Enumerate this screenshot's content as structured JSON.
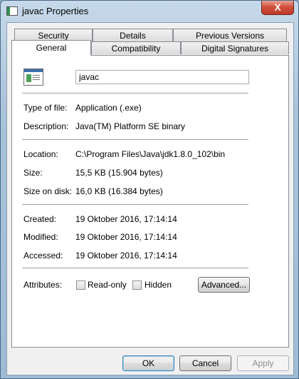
{
  "window": {
    "title": "javac Properties",
    "close_label": "X"
  },
  "tabs": {
    "row1": [
      "Security",
      "Details",
      "Previous Versions"
    ],
    "row2": [
      "General",
      "Compatibility",
      "Digital Signatures"
    ]
  },
  "general": {
    "file_name": "javac",
    "type_label": "Type of file:",
    "type_value": "Application (.exe)",
    "desc_label": "Description:",
    "desc_value": "Java(TM) Platform SE binary",
    "location_label": "Location:",
    "location_value": "C:\\Program Files\\Java\\jdk1.8.0_102\\bin",
    "size_label": "Size:",
    "size_value": "15,5 KB (15.904 bytes)",
    "size_disk_label": "Size on disk:",
    "size_disk_value": "16,0 KB (16.384 bytes)",
    "created_label": "Created:",
    "created_value": "19 Oktober 2016, 17:14:14",
    "modified_label": "Modified:",
    "modified_value": "19 Oktober 2016, 17:14:14",
    "accessed_label": "Accessed:",
    "accessed_value": "19 Oktober 2016, 17:14:14",
    "attributes_label": "Attributes:",
    "readonly_label": "Read-only",
    "readonly_checked": false,
    "hidden_label": "Hidden",
    "hidden_checked": false,
    "advanced_label": "Advanced..."
  },
  "buttons": {
    "ok": "OK",
    "cancel": "Cancel",
    "apply": "Apply"
  }
}
